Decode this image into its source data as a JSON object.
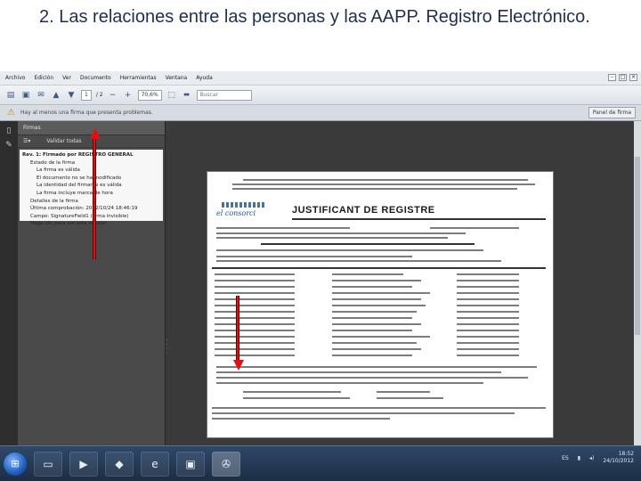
{
  "slide": {
    "title": "2. Las relaciones entre las personas y las AAPP. Registro Electrónico."
  },
  "window": {
    "menu": [
      "Archivo",
      "Edición",
      "Ver",
      "Documento",
      "Herramientas",
      "Ventana",
      "Ayuda"
    ]
  },
  "toolbar": {
    "page_current": "1",
    "page_total": "/ 2",
    "zoom": "70,6%",
    "search_placeholder": "Buscar"
  },
  "notice": {
    "text": "Hay al menos una firma que presenta problemas.",
    "sign_panel_label": "Panel de firma"
  },
  "signature_panel": {
    "header": "Firmas",
    "validate_all": "Validar todas",
    "tree": [
      {
        "level": 1,
        "text": "Rev. 1: Firmado por REGISTRO GENERAL"
      },
      {
        "level": 2,
        "text": "Estado de la firma"
      },
      {
        "level": 3,
        "text": "La firma es válida"
      },
      {
        "level": 3,
        "text": "El documento no se ha modificado"
      },
      {
        "level": 3,
        "text": "La identidad del firmante es válida"
      },
      {
        "level": 3,
        "text": "La firma incluye marca de hora"
      },
      {
        "level": 2,
        "text": "Detalles de la firma"
      },
      {
        "level": 2,
        "text": "Última comprobación: 2012/10/24 18:46:19"
      },
      {
        "level": 2,
        "text": "Campo: SignatureField1 (firma invisible)"
      },
      {
        "level": 2,
        "text": "Haga clic para ver esta versión"
      }
    ]
  },
  "document": {
    "logo": "el consorci",
    "title": "JUSTIFICANT DE REGISTRE"
  },
  "taskbar": {
    "language": "ES",
    "time": "18:52",
    "date": "24/10/2012"
  },
  "colors": {
    "arrow": "#e01010",
    "taskbar": "#1c2d45",
    "title_text": "#1f2f4f"
  }
}
